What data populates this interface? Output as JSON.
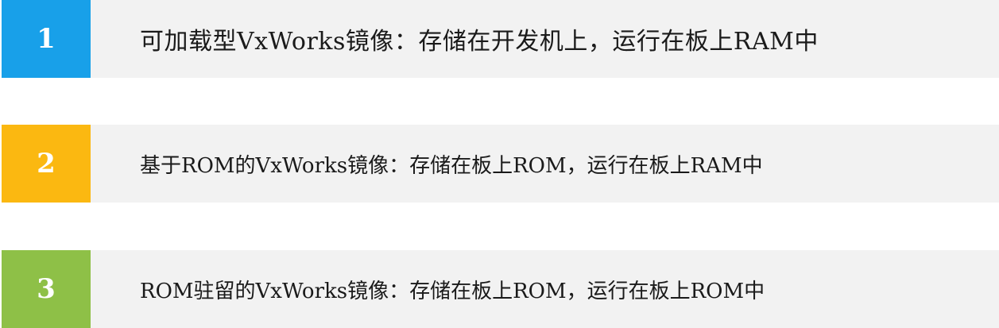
{
  "items": [
    {
      "number": "1",
      "color": "#18a0e9",
      "text": "可加载型VxWorks镜像：存储在开发机上，运行在板上RAM中"
    },
    {
      "number": "2",
      "color": "#fbb811",
      "text": "基于ROM的VxWorks镜像：存储在板上ROM，运行在板上RAM中"
    },
    {
      "number": "3",
      "color": "#8ec047",
      "text": "ROM驻留的VxWorks镜像：存储在板上ROM，运行在板上ROM中"
    }
  ]
}
